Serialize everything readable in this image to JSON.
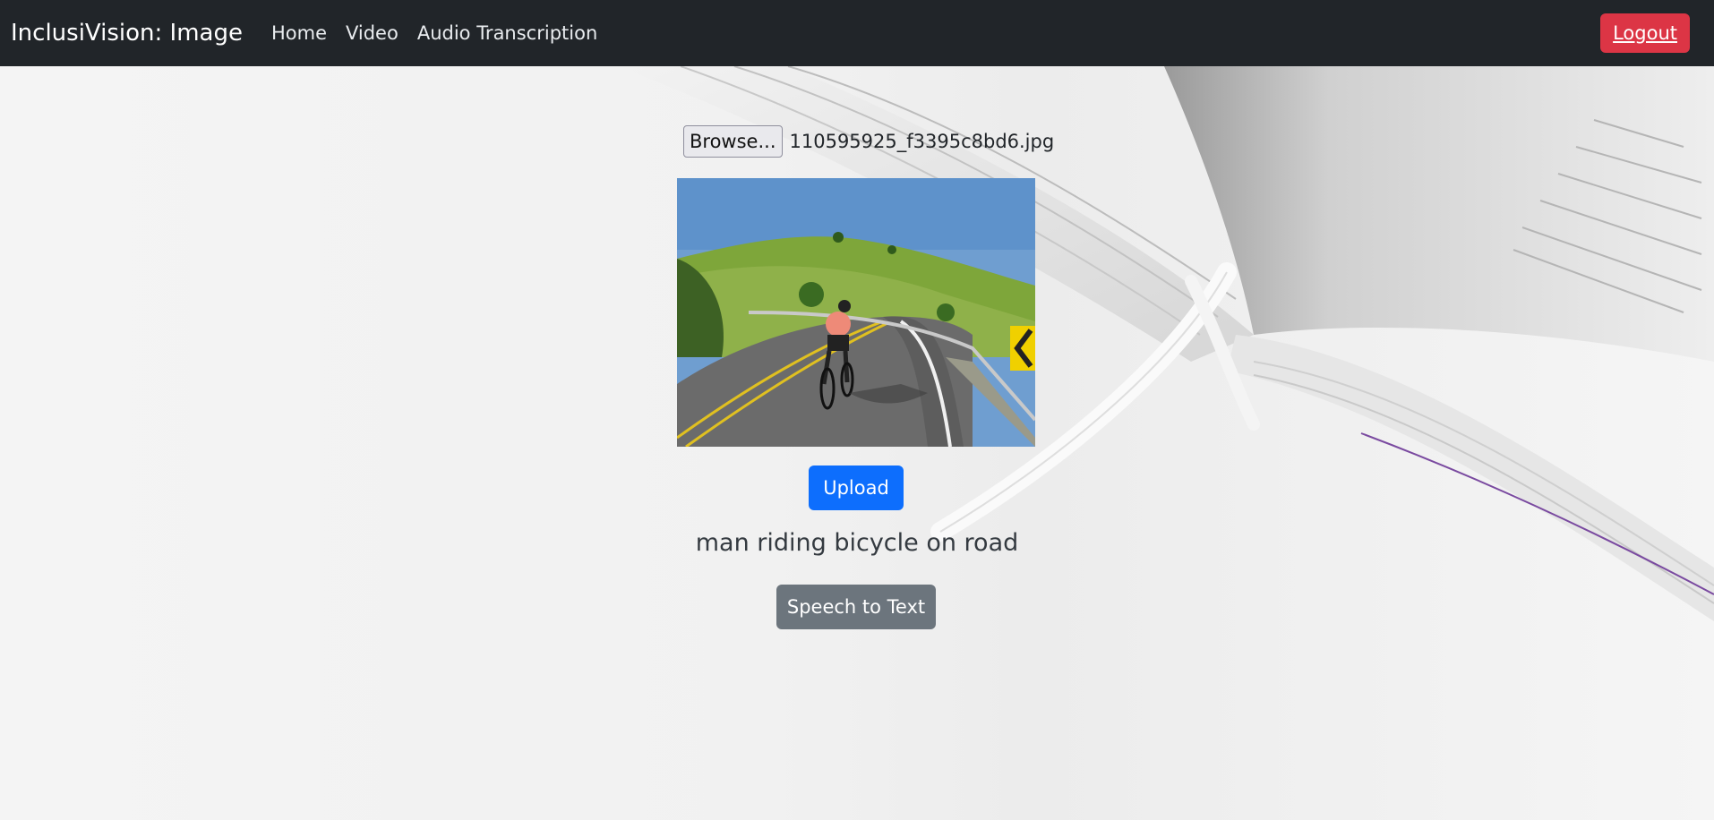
{
  "navbar": {
    "brand": "InclusiVision: Image",
    "links": [
      "Home",
      "Video",
      "Audio Transcription"
    ],
    "logout_label": "Logout"
  },
  "file_input": {
    "browse_label": "Browse...",
    "file_name": "110595925_f3395c8bd6.jpg"
  },
  "upload_label": "Upload",
  "caption": "man riding bicycle on road",
  "speech_label": "Speech to Text",
  "colors": {
    "navbar_bg": "#212529",
    "logout_bg": "#dc3545",
    "upload_bg": "#0d6efd",
    "speech_bg": "#6c757d"
  }
}
